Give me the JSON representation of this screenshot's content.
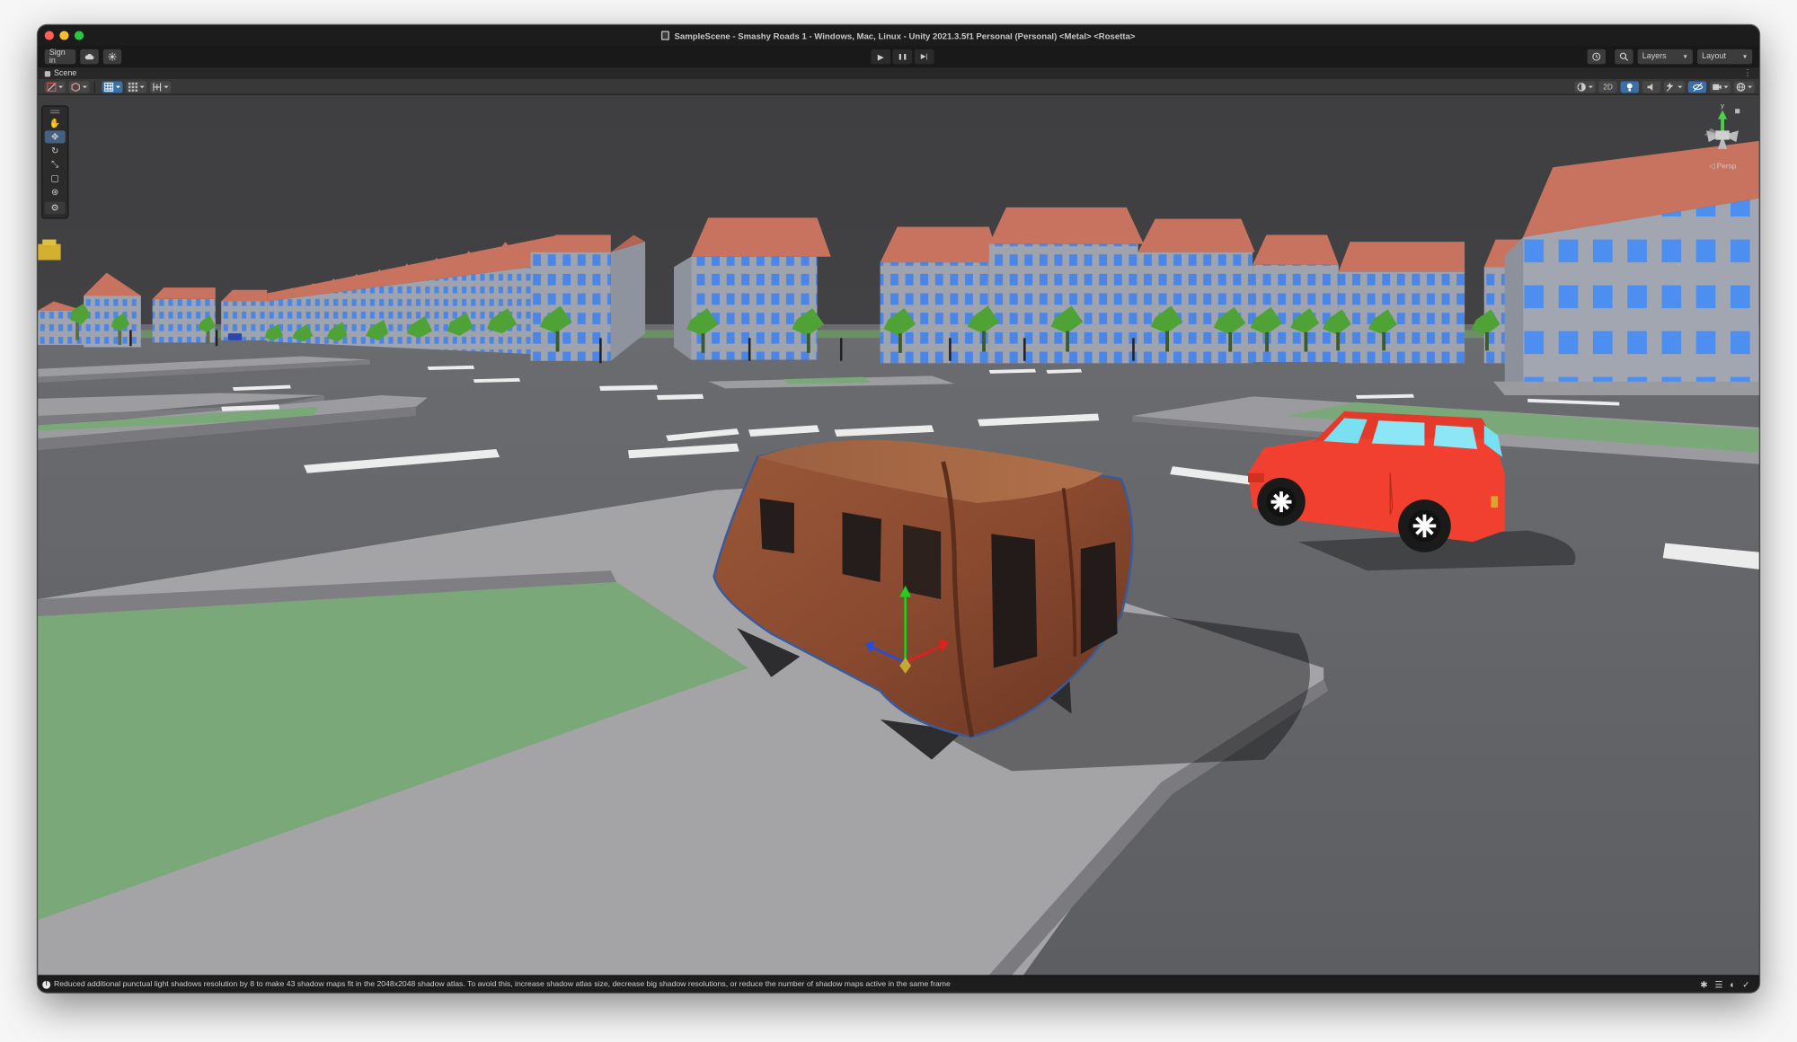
{
  "window": {
    "title": "SampleScene - Smashy Roads 1 - Windows, Mac, Linux - Unity 2021.3.5f1 Personal (Personal) <Metal> <Rosetta>",
    "traffic_lights": {
      "close": "#ff5f57",
      "minimize": "#febc2e",
      "zoom": "#28c840"
    }
  },
  "toolbar": {
    "sign_in": "Sign in",
    "cloud_icon": "cloud-icon",
    "collab_icon": "collab-icon",
    "play": "▶",
    "pause": "❚❚",
    "step": "▶|",
    "history_icon": "history-icon",
    "search_icon": "search-icon",
    "layers": "Layers",
    "layout": "Layout"
  },
  "scene_tab": {
    "label": "Scene",
    "menu": "⋮"
  },
  "scene_toolbar": {
    "twod_label": "2D",
    "left_icons": [
      "draw-mode-icon",
      "shading-icon",
      "grid-snap-icon",
      "increment-snap-icon",
      "pivot-icon"
    ],
    "right_icons": [
      "render-mode-icon",
      "lighting-icon",
      "audio-icon",
      "effects-icon",
      "hidden-objects-icon",
      "camera-icon",
      "gizmos-icon"
    ]
  },
  "tools": [
    "hand-tool-icon",
    "move-tool-icon",
    "rotate-tool-icon",
    "scale-tool-icon",
    "rect-tool-icon",
    "transform-tool-icon",
    "custom-tool-icon"
  ],
  "active_tool": "move-tool-icon",
  "gizmo": {
    "y_label": "y",
    "persp_label": "◁ Persp"
  },
  "status": {
    "message": "Reduced additional punctual light shadows resolution by 8 to make 43 shadow maps fit in the 2048x2048 shadow atlas. To avoid this, increase shadow atlas size, decrease big shadow resolutions, or reduce the number of shadow maps active in the same frame",
    "icons": [
      "debug-icon",
      "progress-icon",
      "lighting-status-icon",
      "check-icon"
    ]
  },
  "colors": {
    "sky": "#434345",
    "road": "#5f6166",
    "sidewalk": "#a4a4a6",
    "grass": "#7aa878",
    "roof": "#c8735f",
    "wall": "#9da2ae",
    "window": "#4d8ff0",
    "tree": "#58b03a",
    "red_car": "#f24030",
    "van": "#8e4f35"
  }
}
